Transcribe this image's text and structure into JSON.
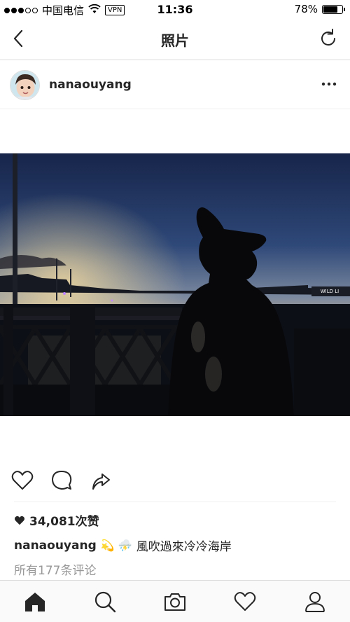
{
  "status_bar": {
    "carrier": "中国电信",
    "vpn": "VPN",
    "time": "11:36",
    "battery": "78%",
    "battery_level": 0.78
  },
  "nav": {
    "title": "照片",
    "back_icon": "chevron-left-icon",
    "refresh_icon": "refresh-icon"
  },
  "post": {
    "username": "nanaouyang",
    "more_icon": "ellipsis-icon",
    "likes": "34,081次赞",
    "caption_user": "nanaouyang",
    "caption_emoji": "💫 ⛈️",
    "caption_text": "風吹過來冷冷海岸",
    "comments_link": "所有177条评论"
  },
  "actions": [
    "heart-icon",
    "comment-icon",
    "share-icon"
  ],
  "tabs": [
    "home-icon",
    "search-icon",
    "camera-icon",
    "activity-heart-icon",
    "profile-icon"
  ],
  "colors": {
    "text": "#262626",
    "muted": "#999999",
    "border": "#dbdbdb"
  }
}
